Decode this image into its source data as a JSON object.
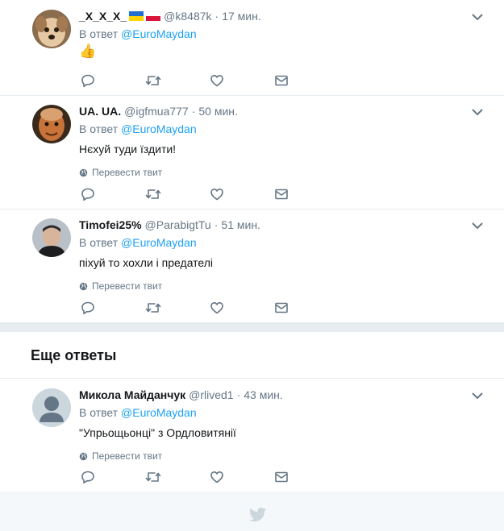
{
  "tweets": [
    {
      "fullname": "_X_X_X_",
      "has_flags": true,
      "username": "@k8487k",
      "time": "17 мин.",
      "reply_prefix": "В ответ",
      "reply_handle": "@EuroMaydan",
      "text": "👍",
      "translate": ""
    },
    {
      "fullname": "UA. UA.",
      "has_flags": false,
      "username": "@igfmua777",
      "time": "50 мин.",
      "reply_prefix": "В ответ",
      "reply_handle": "@EuroMaydan",
      "text": "Нєхуй туди їздити!",
      "translate": "Перевести твит"
    },
    {
      "fullname": "Timofei25%",
      "has_flags": false,
      "username": "@ParabigtTu",
      "time": "51 мин.",
      "reply_prefix": "В ответ",
      "reply_handle": "@EuroMaydan",
      "text": "піхуй то хохли і предателі",
      "translate": "Перевести твит"
    },
    {
      "fullname": "Микола Майданчук",
      "has_flags": false,
      "username": "@rlived1",
      "time": "43 мин.",
      "reply_prefix": "В ответ",
      "reply_handle": "@EuroMaydan",
      "text": "\"Упрьощьонці\" з Ордловитянії",
      "translate": "Перевести твит"
    }
  ],
  "more_replies_title": "Еще ответы",
  "separator": "·",
  "icons": {
    "reply": "reply-icon",
    "retweet": "retweet-icon",
    "like": "heart-icon",
    "dm": "envelope-icon",
    "caret": "chevron-down-icon",
    "globe": "globe-icon",
    "footer": "twitter-bird-icon"
  },
  "colors": {
    "link": "#1da1f2",
    "muted": "#657786",
    "border": "#e6ecf0",
    "footer_bg": "#f5f8fa"
  }
}
